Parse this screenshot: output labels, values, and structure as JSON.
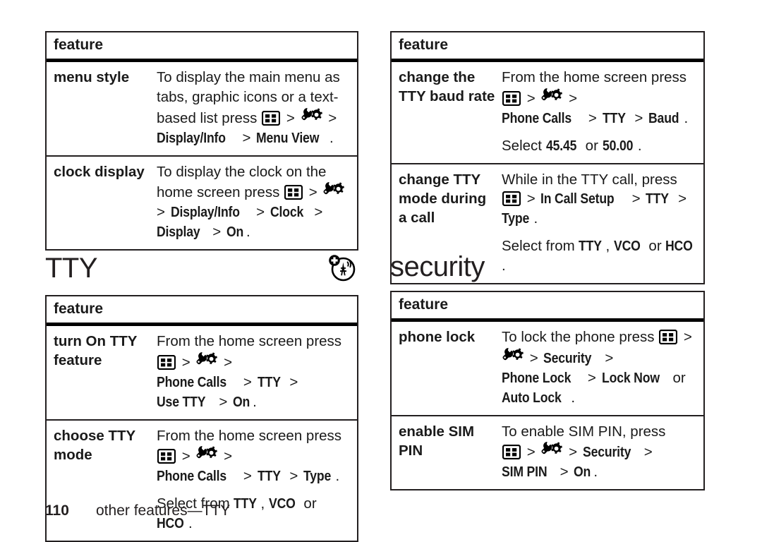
{
  "page": {
    "number": "110",
    "footer_text": "other features—TTY"
  },
  "icons": {
    "menu_key": "menu-grid-icon",
    "settings": "wrench-gear-icon",
    "tty": "tty-antenna-icon"
  },
  "tables": {
    "display_settings": {
      "header": "feature",
      "rows": [
        {
          "feature": "menu style",
          "paragraphs": [
            {
              "parts": [
                {
                  "t": "text",
                  "v": "To display the main menu as tabs, graphic icons or a text-based list press "
                },
                {
                  "t": "icon",
                  "v": "menu_key"
                },
                {
                  "t": "gt",
                  "v": ">"
                },
                {
                  "t": "icon",
                  "v": "settings"
                },
                {
                  "t": "gt",
                  "v": ">"
                },
                {
                  "t": "path",
                  "v": "Display/Info"
                },
                {
                  "t": "gt",
                  "v": ">"
                },
                {
                  "t": "path",
                  "v": "Menu View"
                },
                {
                  "t": "text",
                  "v": "."
                }
              ]
            }
          ]
        },
        {
          "feature": "clock display",
          "paragraphs": [
            {
              "parts": [
                {
                  "t": "text",
                  "v": "To display the clock on the home screen press "
                },
                {
                  "t": "icon",
                  "v": "menu_key"
                },
                {
                  "t": "gt",
                  "v": ">"
                },
                {
                  "t": "icon",
                  "v": "settings"
                },
                {
                  "t": "gt",
                  "v": ">"
                },
                {
                  "t": "path",
                  "v": "Display/Info"
                },
                {
                  "t": "gt",
                  "v": ">"
                },
                {
                  "t": "path",
                  "v": "Clock"
                },
                {
                  "t": "gt",
                  "v": ">"
                },
                {
                  "t": "path",
                  "v": "Display"
                },
                {
                  "t": "gt",
                  "v": ">"
                },
                {
                  "t": "path",
                  "v": "On"
                },
                {
                  "t": "text",
                  "v": "."
                }
              ]
            }
          ]
        }
      ]
    },
    "tty": {
      "header": "feature",
      "rows": [
        {
          "feature": "turn On TTY feature",
          "paragraphs": [
            {
              "parts": [
                {
                  "t": "text",
                  "v": "From the home screen press "
                },
                {
                  "t": "icon",
                  "v": "menu_key"
                },
                {
                  "t": "gt",
                  "v": ">"
                },
                {
                  "t": "icon",
                  "v": "settings"
                },
                {
                  "t": "gt",
                  "v": ">"
                },
                {
                  "t": "br",
                  "v": ""
                },
                {
                  "t": "path",
                  "v": "Phone Calls"
                },
                {
                  "t": "gt",
                  "v": ">"
                },
                {
                  "t": "path",
                  "v": "TTY"
                },
                {
                  "t": "gt",
                  "v": ">"
                },
                {
                  "t": "path",
                  "v": "Use TTY"
                },
                {
                  "t": "gt",
                  "v": ">"
                },
                {
                  "t": "path",
                  "v": "On"
                },
                {
                  "t": "text",
                  "v": "."
                }
              ]
            }
          ]
        },
        {
          "feature": "choose TTY mode",
          "paragraphs": [
            {
              "parts": [
                {
                  "t": "text",
                  "v": "From the home screen press "
                },
                {
                  "t": "icon",
                  "v": "menu_key"
                },
                {
                  "t": "gt",
                  "v": ">"
                },
                {
                  "t": "icon",
                  "v": "settings"
                },
                {
                  "t": "gt",
                  "v": ">"
                },
                {
                  "t": "br",
                  "v": ""
                },
                {
                  "t": "path",
                  "v": "Phone Calls"
                },
                {
                  "t": "gt",
                  "v": ">"
                },
                {
                  "t": "path",
                  "v": "TTY"
                },
                {
                  "t": "gt",
                  "v": ">"
                },
                {
                  "t": "path",
                  "v": "Type"
                },
                {
                  "t": "text",
                  "v": "."
                }
              ]
            },
            {
              "parts": [
                {
                  "t": "text",
                  "v": "Select from "
                },
                {
                  "t": "path",
                  "v": "TTY"
                },
                {
                  "t": "text",
                  "v": ", "
                },
                {
                  "t": "path",
                  "v": "VCO"
                },
                {
                  "t": "text",
                  "v": " or "
                },
                {
                  "t": "path",
                  "v": "HCO"
                },
                {
                  "t": "text",
                  "v": "."
                }
              ]
            }
          ]
        }
      ]
    },
    "tty_baud": {
      "header": "feature",
      "rows": [
        {
          "feature": "change the TTY baud rate",
          "paragraphs": [
            {
              "parts": [
                {
                  "t": "text",
                  "v": "From the home screen press "
                },
                {
                  "t": "icon",
                  "v": "menu_key"
                },
                {
                  "t": "gt",
                  "v": ">"
                },
                {
                  "t": "icon",
                  "v": "settings"
                },
                {
                  "t": "gt",
                  "v": ">"
                },
                {
                  "t": "br",
                  "v": ""
                },
                {
                  "t": "path",
                  "v": "Phone Calls"
                },
                {
                  "t": "gt",
                  "v": ">"
                },
                {
                  "t": "path",
                  "v": "TTY"
                },
                {
                  "t": "gt",
                  "v": ">"
                },
                {
                  "t": "path",
                  "v": "Baud"
                },
                {
                  "t": "text",
                  "v": "."
                }
              ]
            },
            {
              "parts": [
                {
                  "t": "text",
                  "v": "Select "
                },
                {
                  "t": "path",
                  "v": "45.45"
                },
                {
                  "t": "text",
                  "v": " or "
                },
                {
                  "t": "path",
                  "v": "50.00"
                },
                {
                  "t": "text",
                  "v": "."
                }
              ]
            }
          ]
        },
        {
          "feature": "change TTY mode during a call",
          "paragraphs": [
            {
              "parts": [
                {
                  "t": "text",
                  "v": "While in the TTY call, press "
                },
                {
                  "t": "icon",
                  "v": "menu_key"
                },
                {
                  "t": "gt",
                  "v": ">"
                },
                {
                  "t": "path",
                  "v": "In Call Setup"
                },
                {
                  "t": "gt",
                  "v": ">"
                },
                {
                  "t": "path",
                  "v": "TTY"
                },
                {
                  "t": "gt",
                  "v": ">"
                },
                {
                  "t": "path",
                  "v": "Type"
                },
                {
                  "t": "text",
                  "v": "."
                }
              ]
            },
            {
              "parts": [
                {
                  "t": "text",
                  "v": "Select from "
                },
                {
                  "t": "path",
                  "v": "TTY"
                },
                {
                  "t": "text",
                  "v": ", "
                },
                {
                  "t": "path",
                  "v": "VCO"
                },
                {
                  "t": "text",
                  "v": " or "
                },
                {
                  "t": "path",
                  "v": "HCO"
                },
                {
                  "t": "text",
                  "v": "."
                }
              ]
            }
          ]
        }
      ]
    },
    "security": {
      "header": "feature",
      "rows": [
        {
          "feature": "phone lock",
          "paragraphs": [
            {
              "parts": [
                {
                  "t": "text",
                  "v": "To lock the phone press "
                },
                {
                  "t": "icon",
                  "v": "menu_key"
                },
                {
                  "t": "gt",
                  "v": ">"
                },
                {
                  "t": "icon",
                  "v": "settings"
                },
                {
                  "t": "gt",
                  "v": ">"
                },
                {
                  "t": "path",
                  "v": "Security"
                },
                {
                  "t": "gt",
                  "v": ">"
                },
                {
                  "t": "path",
                  "v": "Phone Lock"
                },
                {
                  "t": "gt",
                  "v": ">"
                },
                {
                  "t": "path",
                  "v": "Lock Now"
                },
                {
                  "t": "text",
                  "v": " or "
                },
                {
                  "t": "path",
                  "v": "Auto Lock"
                },
                {
                  "t": "text",
                  "v": "."
                }
              ]
            }
          ]
        },
        {
          "feature": "enable SIM PIN",
          "paragraphs": [
            {
              "parts": [
                {
                  "t": "text",
                  "v": "To enable SIM PIN, press "
                },
                {
                  "t": "br",
                  "v": ""
                },
                {
                  "t": "icon",
                  "v": "menu_key"
                },
                {
                  "t": "gt",
                  "v": ">"
                },
                {
                  "t": "icon",
                  "v": "settings"
                },
                {
                  "t": "gt",
                  "v": ">"
                },
                {
                  "t": "path",
                  "v": "Security"
                },
                {
                  "t": "gt",
                  "v": ">"
                },
                {
                  "t": "path",
                  "v": "SIM PIN"
                },
                {
                  "t": "gt",
                  "v": ">"
                },
                {
                  "t": "path",
                  "v": "On"
                },
                {
                  "t": "text",
                  "v": "."
                }
              ]
            }
          ]
        }
      ]
    }
  },
  "headings": {
    "tty": "TTY",
    "security": "security"
  },
  "colors": {
    "text": "#231f20",
    "rule": "#231f20",
    "background": "#ffffff"
  }
}
